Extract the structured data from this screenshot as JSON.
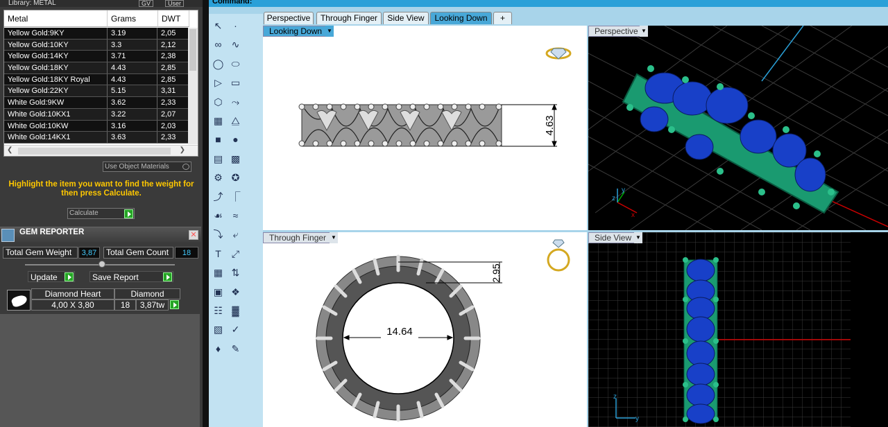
{
  "library": {
    "title": "Library: METAL",
    "sel1": "GV",
    "sel2": "User"
  },
  "metal_table": {
    "headers": [
      "Metal",
      "Grams",
      "DWT"
    ],
    "rows": [
      [
        "Yellow Gold:9KY",
        "3.19",
        "2,05"
      ],
      [
        "Yellow Gold:10KY",
        "3.3",
        "2,12"
      ],
      [
        "Yellow Gold:14KY",
        "3.71",
        "2,38"
      ],
      [
        "Yellow Gold:18KY",
        "4.43",
        "2,85"
      ],
      [
        "Yellow Gold:18KY Royal",
        "4.43",
        "2,85"
      ],
      [
        "Yellow Gold:22KY",
        "5.15",
        "3,31"
      ],
      [
        "White Gold:9KW",
        "3.62",
        "2,33"
      ],
      [
        "White Gold:10KX1",
        "3.22",
        "2,07"
      ],
      [
        "White Gold:10KW",
        "3.16",
        "2,03"
      ],
      [
        "White Gold:14KX1",
        "3.63",
        "2,33"
      ]
    ]
  },
  "use_object_materials": "Use Object Materials",
  "hint": "Highlight the item you want to find the weight for then press Calculate.",
  "calculate": "Calculate",
  "gem_reporter": {
    "title": "GEM REPORTER",
    "total_weight_label": "Total Gem Weight",
    "total_weight": "3,87",
    "total_count_label": "Total Gem Count",
    "total_count": "18",
    "update": "Update",
    "save_report": "Save Report",
    "gem": {
      "shape": "Diamond Heart",
      "material": "Diamond",
      "size": "4,00 X 3,80",
      "count": "18",
      "tw": "3,87tw"
    }
  },
  "command": "Command:",
  "tabs": [
    "Perspective",
    "Through Finger",
    "Side View",
    "Looking Down",
    "+"
  ],
  "active_tab": "Looking Down",
  "viewports": {
    "looking_down": {
      "label": "Looking Down",
      "dimension": "4.63"
    },
    "perspective": {
      "label": "Perspective"
    },
    "through_finger": {
      "label": "Through Finger",
      "dim_diameter": "14.64",
      "dim_height": "2.95"
    },
    "side_view": {
      "label": "Side View"
    }
  },
  "colors": {
    "accent": "#2aa0d8",
    "hint": "#ffc800",
    "gem_blue": "#1840c8",
    "prong_green": "#1a9a70"
  }
}
